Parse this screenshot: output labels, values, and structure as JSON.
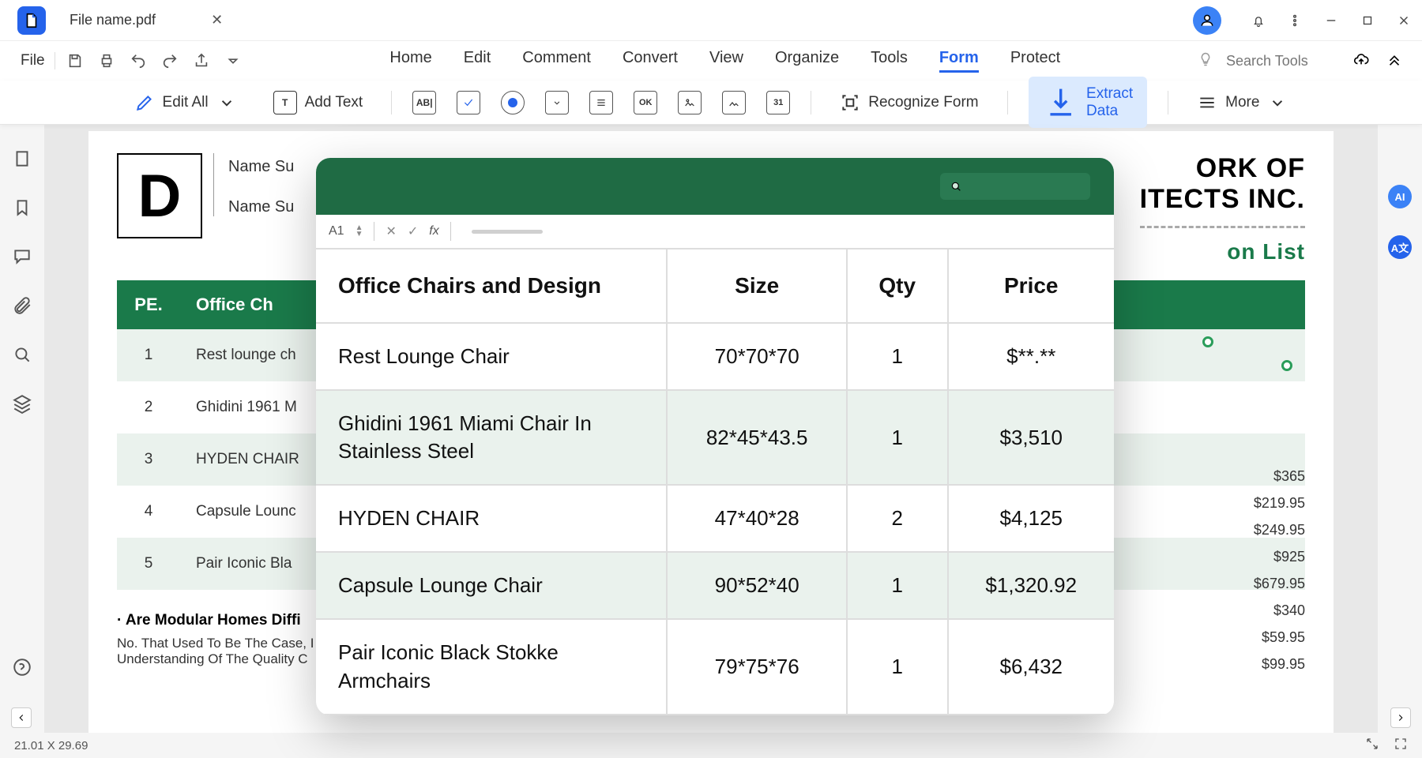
{
  "tab": {
    "filename": "File name.pdf"
  },
  "menu": {
    "file": "File",
    "tabs": [
      "Home",
      "Edit",
      "Comment",
      "Convert",
      "View",
      "Organize",
      "Tools",
      "Form",
      "Protect"
    ],
    "active": "Form",
    "search_placeholder": "Search Tools"
  },
  "toolbar": {
    "edit_all": "Edit All",
    "add_text": "Add Text",
    "recognize_form": "Recognize Form",
    "extract_data": "Extract Data",
    "more": "More"
  },
  "document": {
    "logo_letter": "D",
    "field1": "Name Su",
    "field2": "Name Su",
    "title_line1": "ORK OF",
    "title_line2": "ITECTS INC.",
    "list_title": "on List",
    "bg_head_pe": "PE.",
    "bg_head_name": "Office Ch",
    "bg_rows": [
      {
        "n": "1",
        "t": "Rest lounge ch"
      },
      {
        "n": "2",
        "t": "Ghidini 1961 M"
      },
      {
        "n": "3",
        "t": "HYDEN CHAIR"
      },
      {
        "n": "4",
        "t": "Capsule Lounc"
      },
      {
        "n": "5",
        "t": "Pair Iconic Bla"
      }
    ],
    "faq_q": "· Are Modular Homes Diffi",
    "faq_a": "No. That Used To Be The Case, I\nUnderstanding Of The Quality C",
    "prices": [
      "$365",
      "$219.95",
      "$249.95",
      "$925",
      "$679.95",
      "$340",
      "$59.95",
      "$99.95"
    ]
  },
  "overlay": {
    "cell_ref": "A1",
    "headers": [
      "Office Chairs and Design",
      "Size",
      "Qty",
      "Price"
    ],
    "rows": [
      {
        "name": "Rest Lounge Chair",
        "size": "70*70*70",
        "qty": "1",
        "price": "$**.**"
      },
      {
        "name": "Ghidini 1961 Miami Chair In Stainless Steel",
        "size": "82*45*43.5",
        "qty": "1",
        "price": "$3,510"
      },
      {
        "name": "HYDEN CHAIR",
        "size": "47*40*28",
        "qty": "2",
        "price": "$4,125"
      },
      {
        "name": "Capsule Lounge Chair",
        "size": "90*52*40",
        "qty": "1",
        "price": "$1,320.92"
      },
      {
        "name": "Pair Iconic Black Stokke Armchairs",
        "size": "79*75*76",
        "qty": "1",
        "price": "$6,432"
      }
    ]
  },
  "status": {
    "dims": "21.01 X 29.69"
  }
}
